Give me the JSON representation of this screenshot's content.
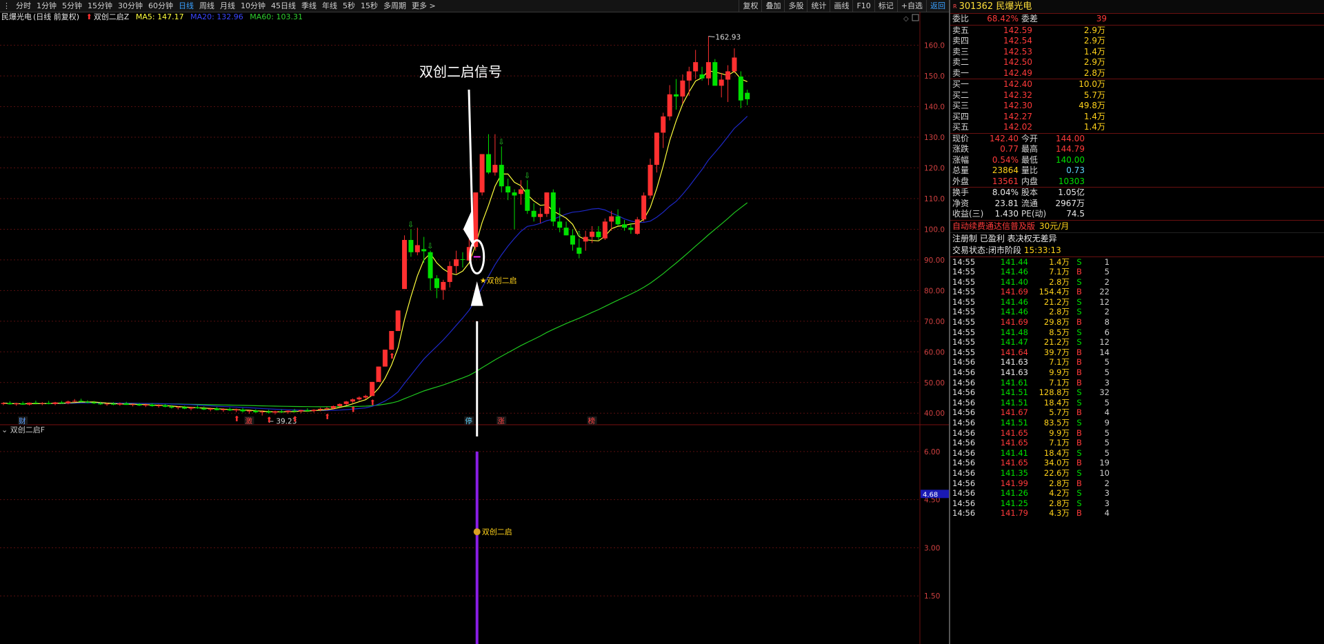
{
  "toolbar": {
    "left": [
      "分时",
      "1分钟",
      "5分钟",
      "15分钟",
      "30分钟",
      "60分钟",
      "日线",
      "周线",
      "月线",
      "10分钟",
      "45日线",
      "季线",
      "年线",
      "5秒",
      "15秒",
      "多周期",
      "更多 >"
    ],
    "active": "日线",
    "right": [
      "复权",
      "叠加",
      "多股",
      "统计",
      "画线",
      "F10",
      "标记",
      "+自选",
      "返回"
    ]
  },
  "legend": {
    "stock": "民爆光电",
    "mode": "(日线 前复权)",
    "indicator": "双创二启Z",
    "ma5": "MA5: 147.17",
    "ma20": "MA20: 132.96",
    "ma60": "MA60: 103.31"
  },
  "colors": {
    "up": "#ff3030",
    "down": "#00e000",
    "ma5": "#ffff3c",
    "ma20": "#1e28c8",
    "ma60": "#1fc81f",
    "indicator": "#8a1ee6"
  },
  "annotation": {
    "text": "双创二启信号",
    "signal_label": "★双创二启",
    "sub_label": "双创二启"
  },
  "price_axis": [
    "160.0",
    "150.0",
    "140.0",
    "130.0",
    "120.0",
    "110.0",
    "100.0",
    "90.00",
    "80.00",
    "70.00",
    "60.00",
    "50.00",
    "40.00"
  ],
  "high_label": "162.93",
  "low_label": "← 39.23",
  "events": [
    "财",
    "激",
    "停",
    "涨",
    "榜"
  ],
  "sub_panel": {
    "title": "双创二启F",
    "axis": [
      "6.00",
      "4.50",
      "3.00",
      "1.50"
    ],
    "current": "4.68"
  },
  "chart_data": {
    "type": "candlestick",
    "ylim": [
      36,
      166
    ],
    "candles": [
      [
        43,
        43.6,
        42.6,
        43.3
      ],
      [
        43.3,
        43.9,
        42.8,
        42.9
      ],
      [
        42.9,
        43.4,
        42.4,
        43.2
      ],
      [
        43.2,
        43.8,
        42.7,
        42.8
      ],
      [
        42.8,
        43.5,
        42.5,
        43.4
      ],
      [
        43.4,
        44.1,
        43.0,
        43.1
      ],
      [
        43.1,
        43.6,
        42.6,
        43.3
      ],
      [
        43.3,
        44.0,
        42.9,
        43.0
      ],
      [
        43.0,
        43.7,
        42.6,
        43.5
      ],
      [
        43.5,
        44.0,
        43.1,
        43.2
      ],
      [
        43.2,
        44.1,
        42.9,
        43.8
      ],
      [
        43.8,
        44.6,
        43.5,
        44.0
      ],
      [
        44.0,
        44.7,
        43.6,
        43.7
      ],
      [
        43.7,
        44.2,
        43.2,
        43.5
      ],
      [
        43.5,
        44.0,
        43.0,
        43.2
      ],
      [
        43.2,
        43.7,
        42.7,
        42.9
      ],
      [
        42.9,
        43.4,
        42.4,
        43.1
      ],
      [
        43.1,
        43.6,
        42.6,
        42.8
      ],
      [
        42.8,
        43.5,
        42.4,
        43.2
      ],
      [
        43.2,
        43.7,
        42.7,
        42.7
      ],
      [
        42.7,
        43.2,
        42.2,
        42.9
      ],
      [
        42.9,
        43.3,
        42.3,
        42.5
      ],
      [
        42.5,
        43.1,
        42.0,
        42.8
      ],
      [
        42.8,
        43.2,
        42.1,
        42.3
      ],
      [
        42.3,
        42.9,
        41.8,
        42.6
      ],
      [
        42.6,
        43.0,
        41.9,
        42.1
      ],
      [
        42.1,
        42.6,
        41.5,
        41.8
      ],
      [
        41.8,
        42.3,
        41.2,
        42.0
      ],
      [
        42.0,
        42.4,
        41.3,
        41.5
      ],
      [
        41.5,
        42.1,
        40.9,
        41.9
      ],
      [
        41.9,
        42.5,
        41.4,
        41.6
      ],
      [
        41.6,
        42.2,
        41.0,
        41.2
      ],
      [
        41.2,
        41.8,
        40.6,
        41.5
      ],
      [
        41.5,
        42.0,
        40.9,
        41.0
      ],
      [
        41.0,
        41.6,
        40.4,
        41.3
      ],
      [
        41.3,
        41.8,
        40.7,
        40.9
      ],
      [
        40.9,
        41.5,
        40.3,
        41.2
      ],
      [
        41.2,
        41.7,
        40.2,
        40.6
      ],
      [
        40.6,
        41.0,
        39.8,
        40.8
      ],
      [
        40.8,
        41.3,
        40.1,
        40.3
      ],
      [
        40.3,
        40.9,
        39.23,
        40.5
      ],
      [
        40.5,
        41.1,
        39.9,
        40.2
      ],
      [
        40.2,
        40.8,
        39.6,
        40.6
      ],
      [
        40.6,
        41.2,
        40.0,
        40.4
      ],
      [
        40.4,
        40.9,
        39.8,
        40.8
      ],
      [
        40.8,
        41.4,
        40.2,
        40.6
      ],
      [
        40.6,
        41.1,
        40.0,
        41.0
      ],
      [
        41.0,
        41.6,
        40.4,
        40.7
      ],
      [
        40.7,
        41.3,
        40.2,
        41.1
      ],
      [
        41.1,
        41.8,
        40.6,
        41.4
      ],
      [
        41.4,
        42.0,
        40.9,
        41.6
      ],
      [
        41.6,
        42.5,
        41.2,
        42.3
      ],
      [
        42.3,
        43.2,
        41.9,
        43.0
      ],
      [
        43.0,
        44.0,
        42.6,
        43.8
      ],
      [
        43.8,
        44.8,
        43.3,
        44.5
      ],
      [
        44.5,
        45.5,
        44.0,
        45.1
      ],
      [
        45.1,
        46.0,
        44.6,
        45.6
      ],
      [
        45.6,
        50.2,
        45.6,
        50.2
      ],
      [
        50.2,
        55.2,
        50.2,
        55.2
      ],
      [
        55.2,
        60.7,
        55.2,
        60.7
      ],
      [
        60.7,
        66.8,
        60.7,
        66.8
      ],
      [
        66.8,
        73.5,
        66.8,
        73.5
      ],
      [
        80.5,
        98,
        80.5,
        96.5
      ],
      [
        96.5,
        100,
        91,
        92.5
      ],
      [
        92.5,
        100.5,
        91.5,
        94.8
      ],
      [
        93.5,
        97.5,
        89,
        92.8
      ],
      [
        92.5,
        93,
        80,
        84
      ],
      [
        84,
        85,
        77.5,
        80.8
      ],
      [
        80.2,
        83.5,
        77,
        82.8
      ],
      [
        82.8,
        89.5,
        81,
        88
      ],
      [
        88,
        93,
        85.5,
        90.2
      ],
      [
        90.2,
        92.5,
        87.5,
        90
      ],
      [
        89.8,
        98,
        89.6,
        94.2
      ],
      [
        94.2,
        106,
        93,
        112
      ],
      [
        112,
        122,
        111,
        124.5
      ],
      [
        124.5,
        131,
        118,
        118.5
      ],
      [
        118.5,
        131,
        117.5,
        121
      ],
      [
        121,
        127,
        112,
        114
      ],
      [
        114,
        116.5,
        109.5,
        112
      ],
      [
        112,
        113,
        100,
        111
      ],
      [
        111.5,
        116,
        108,
        113
      ],
      [
        113,
        116,
        105,
        106
      ],
      [
        106,
        108.5,
        102.5,
        104
      ],
      [
        104,
        107,
        102,
        105
      ],
      [
        105,
        112,
        104,
        112
      ],
      [
        112,
        113,
        101,
        102.5
      ],
      [
        102.5,
        107,
        99,
        100.5
      ],
      [
        100.5,
        102.5,
        98,
        98
      ],
      [
        98,
        100,
        93,
        95
      ],
      [
        94,
        97,
        90.5,
        92
      ],
      [
        96,
        99.5,
        93,
        97.5
      ],
      [
        97.5,
        101,
        95.5,
        99.2
      ],
      [
        99.2,
        101,
        96.5,
        97.4
      ],
      [
        97,
        103.5,
        96.5,
        102.5
      ],
      [
        102.5,
        106,
        99.5,
        104.2
      ],
      [
        104.2,
        106.5,
        101.2,
        101.6
      ],
      [
        101.6,
        103,
        99.5,
        100.5
      ],
      [
        100.5,
        102,
        98.5,
        99.8
      ],
      [
        98.5,
        104,
        98.2,
        103.2
      ],
      [
        103.2,
        112,
        102.5,
        111
      ],
      [
        111,
        123,
        110,
        121
      ],
      [
        121,
        131,
        118.5,
        131.5
      ],
      [
        131.5,
        138,
        126.5,
        136.8
      ],
      [
        136.8,
        147,
        135.5,
        144
      ],
      [
        144,
        149,
        139,
        143.3
      ],
      [
        143.3,
        150.5,
        141,
        148.5
      ],
      [
        148.5,
        153,
        143.5,
        151.5
      ],
      [
        151.5,
        158.5,
        149,
        154.5
      ],
      [
        150.5,
        153,
        148.5,
        149.2
      ],
      [
        149.2,
        162.93,
        147,
        154.5
      ],
      [
        154.5,
        155.5,
        148,
        146.8
      ],
      [
        146.8,
        151,
        143,
        148.8
      ],
      [
        148.8,
        153.5,
        141.5,
        151.5
      ],
      [
        151.5,
        159,
        151,
        156
      ],
      [
        149.8,
        151.5,
        139.5,
        142
      ],
      [
        144.5,
        145.5,
        140.5,
        142.4
      ]
    ],
    "ma5_x_pos_note": "",
    "signal_markers": [
      "★双创二启"
    ],
    "sub_value": 4.68
  },
  "panel": {
    "code": "301362",
    "name": "民爆光电",
    "weibi_label": "委比",
    "weibi": "68.42%",
    "weicha_label": "委差",
    "weicha": "39",
    "asks": [
      {
        "label": "卖五",
        "price": "142.59",
        "vol": "2.9万"
      },
      {
        "label": "卖四",
        "price": "142.54",
        "vol": "2.9万"
      },
      {
        "label": "卖三",
        "price": "142.53",
        "vol": "1.4万"
      },
      {
        "label": "卖二",
        "price": "142.50",
        "vol": "2.9万"
      },
      {
        "label": "卖一",
        "price": "142.49",
        "vol": "2.8万"
      }
    ],
    "bids": [
      {
        "label": "买一",
        "price": "142.40",
        "vol": "10.0万"
      },
      {
        "label": "买二",
        "price": "142.32",
        "vol": "5.7万"
      },
      {
        "label": "买三",
        "price": "142.30",
        "vol": "49.8万"
      },
      {
        "label": "买四",
        "price": "142.27",
        "vol": "1.4万"
      },
      {
        "label": "买五",
        "price": "142.02",
        "vol": "1.4万"
      }
    ],
    "quote": [
      {
        "l1": "现价",
        "v1": "142.40",
        "c1": "red",
        "l2": "今开",
        "v2": "144.00",
        "c2": "red"
      },
      {
        "l1": "涨跌",
        "v1": "0.77",
        "c1": "red",
        "l2": "最高",
        "v2": "144.79",
        "c2": "red"
      },
      {
        "l1": "涨幅",
        "v1": "0.54%",
        "c1": "red",
        "l2": "最低",
        "v2": "140.00",
        "c2": "green"
      },
      {
        "l1": "总量",
        "v1": "23864",
        "c1": "yel",
        "l2": "量比",
        "v2": "0.73",
        "c2": "cyan"
      },
      {
        "l1": "外盘",
        "v1": "13561",
        "c1": "red",
        "l2": "内盘",
        "v2": "10303",
        "c2": "green"
      }
    ],
    "fund": [
      {
        "l1": "换手",
        "v1": "8.04%",
        "l2": "股本",
        "v2": "1.05亿"
      },
      {
        "l1": "净资",
        "v1": "23.81",
        "l2": "流通",
        "v2": "2967万"
      },
      {
        "l1": "收益(三)",
        "v1": "1.430",
        "l2": "PE(动)",
        "v2": "74.5"
      }
    ],
    "promo": "自动续费通达信普及版",
    "promo_price": "30元/月",
    "reg": "注册制 已盈利 表决权无差异",
    "status_label": "交易状态:",
    "status": "闭市阶段",
    "status_time": "15:33:13",
    "ticks": [
      {
        "t": "14:55",
        "p": "141.44",
        "pc": "green",
        "v": "1.4万",
        "bs": "S",
        "n": "1"
      },
      {
        "t": "14:55",
        "p": "141.46",
        "pc": "green",
        "v": "7.1万",
        "bs": "B",
        "n": "5"
      },
      {
        "t": "14:55",
        "p": "141.40",
        "pc": "green",
        "v": "2.8万",
        "bs": "S",
        "n": "2"
      },
      {
        "t": "14:55",
        "p": "141.69",
        "pc": "red",
        "v": "154.4万",
        "bs": "B",
        "n": "22"
      },
      {
        "t": "14:55",
        "p": "141.46",
        "pc": "green",
        "v": "21.2万",
        "bs": "S",
        "n": "12"
      },
      {
        "t": "14:55",
        "p": "141.46",
        "pc": "green",
        "v": "2.8万",
        "bs": "S",
        "n": "2"
      },
      {
        "t": "14:55",
        "p": "141.69",
        "pc": "red",
        "v": "29.8万",
        "bs": "B",
        "n": "8"
      },
      {
        "t": "14:55",
        "p": "141.48",
        "pc": "green",
        "v": "8.5万",
        "bs": "S",
        "n": "6"
      },
      {
        "t": "14:55",
        "p": "141.47",
        "pc": "green",
        "v": "21.2万",
        "bs": "S",
        "n": "12"
      },
      {
        "t": "14:55",
        "p": "141.64",
        "pc": "red",
        "v": "39.7万",
        "bs": "B",
        "n": "14"
      },
      {
        "t": "14:56",
        "p": "141.63",
        "pc": "white",
        "v": "7.1万",
        "bs": "B",
        "n": "5"
      },
      {
        "t": "14:56",
        "p": "141.63",
        "pc": "white",
        "v": "9.9万",
        "bs": "B",
        "n": "5"
      },
      {
        "t": "14:56",
        "p": "141.61",
        "pc": "green",
        "v": "7.1万",
        "bs": "B",
        "n": "3"
      },
      {
        "t": "14:56",
        "p": "141.51",
        "pc": "green",
        "v": "128.8万",
        "bs": "S",
        "n": "32"
      },
      {
        "t": "14:56",
        "p": "141.51",
        "pc": "green",
        "v": "18.4万",
        "bs": "S",
        "n": "5"
      },
      {
        "t": "14:56",
        "p": "141.67",
        "pc": "red",
        "v": "5.7万",
        "bs": "B",
        "n": "4"
      },
      {
        "t": "14:56",
        "p": "141.51",
        "pc": "green",
        "v": "83.5万",
        "bs": "S",
        "n": "9"
      },
      {
        "t": "14:56",
        "p": "141.65",
        "pc": "red",
        "v": "9.9万",
        "bs": "B",
        "n": "5"
      },
      {
        "t": "14:56",
        "p": "141.65",
        "pc": "red",
        "v": "7.1万",
        "bs": "B",
        "n": "5"
      },
      {
        "t": "14:56",
        "p": "141.41",
        "pc": "green",
        "v": "18.4万",
        "bs": "S",
        "n": "5"
      },
      {
        "t": "14:56",
        "p": "141.65",
        "pc": "red",
        "v": "34.0万",
        "bs": "B",
        "n": "19"
      },
      {
        "t": "14:56",
        "p": "141.35",
        "pc": "green",
        "v": "22.6万",
        "bs": "S",
        "n": "10"
      },
      {
        "t": "14:56",
        "p": "141.99",
        "pc": "red",
        "v": "2.8万",
        "bs": "B",
        "n": "2"
      },
      {
        "t": "14:56",
        "p": "141.26",
        "pc": "green",
        "v": "4.2万",
        "bs": "S",
        "n": "3"
      },
      {
        "t": "14:56",
        "p": "141.25",
        "pc": "green",
        "v": "2.8万",
        "bs": "S",
        "n": "3"
      },
      {
        "t": "14:56",
        "p": "141.79",
        "pc": "red",
        "v": "4.3万",
        "bs": "B",
        "n": "4"
      }
    ]
  }
}
